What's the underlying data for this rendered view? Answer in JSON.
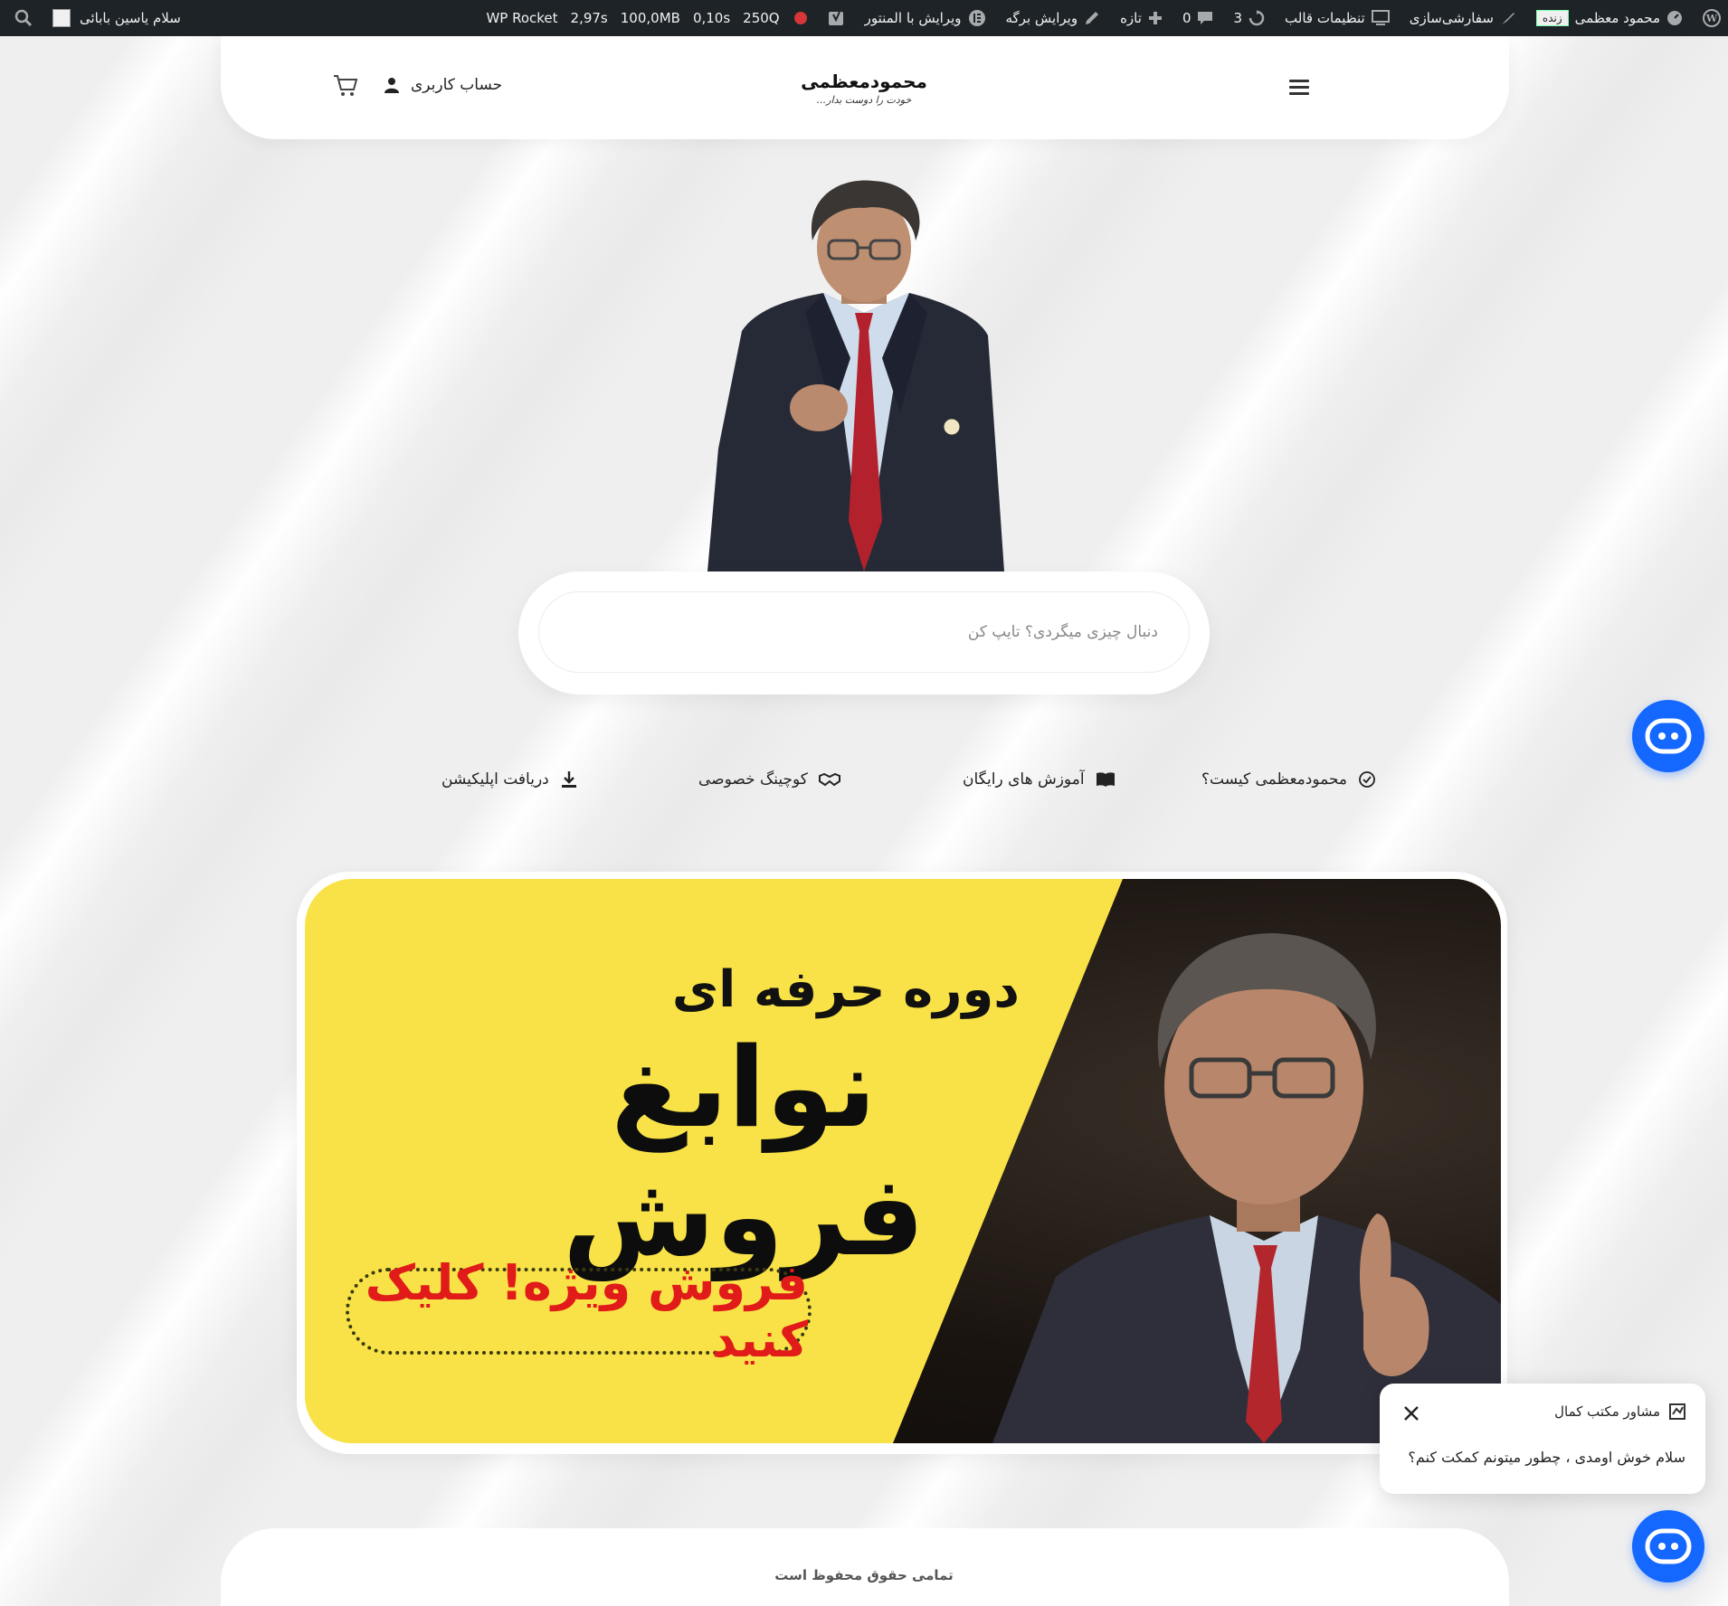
{
  "adminbar": {
    "site_name": "محمود معظمی",
    "live_badge": "زنده",
    "customize": "سفارشی‌سازی",
    "theme_settings": "تنظیمات قالب",
    "updates_count": "3",
    "comments_count": "0",
    "new_label": "تازه",
    "edit_page": "ویرایش برگه",
    "edit_elementor": "ویرایش با المنتور",
    "rocket_label": "WP Rocket",
    "stat_time": "2,97s",
    "stat_mem": "100,0MB",
    "stat_db": "0,10s",
    "stat_queries": "250Q",
    "greeting": "سلام یاسین بابائی"
  },
  "header": {
    "logo_title": "محمودمعظمی",
    "logo_subtitle": "خودت را دوست بدار...",
    "account_label": "حساب کاربری"
  },
  "search": {
    "placeholder": "دنبال چیزی میگردی؟ تایپ کن"
  },
  "links": [
    {
      "label": "محمودمعظمی کیست؟",
      "icon": "check-circle-icon"
    },
    {
      "label": "آموزش های رایگان",
      "icon": "book-icon"
    },
    {
      "label": "کوچینگ خصوصی",
      "icon": "handshake-icon"
    },
    {
      "label": "دریافت اپلیکیشن",
      "icon": "download-icon"
    }
  ],
  "banner": {
    "line1": "دوره حرفه ای",
    "line2": "نوابغ فروش",
    "cta": "فروش ویژه! کلیک کنید"
  },
  "footer": {
    "copyright": "تمامی حقوق محفوظ است"
  },
  "chat": {
    "title": "مشاور مکتب کمال",
    "message": "سلام خوش اومدی ، چطور میتونم کمکت کنم؟"
  },
  "colors": {
    "accent_blue": "#1467ff",
    "banner_yellow": "#f9e247",
    "cta_red": "#e11a1a",
    "adminbar_bg": "#1d2327"
  }
}
